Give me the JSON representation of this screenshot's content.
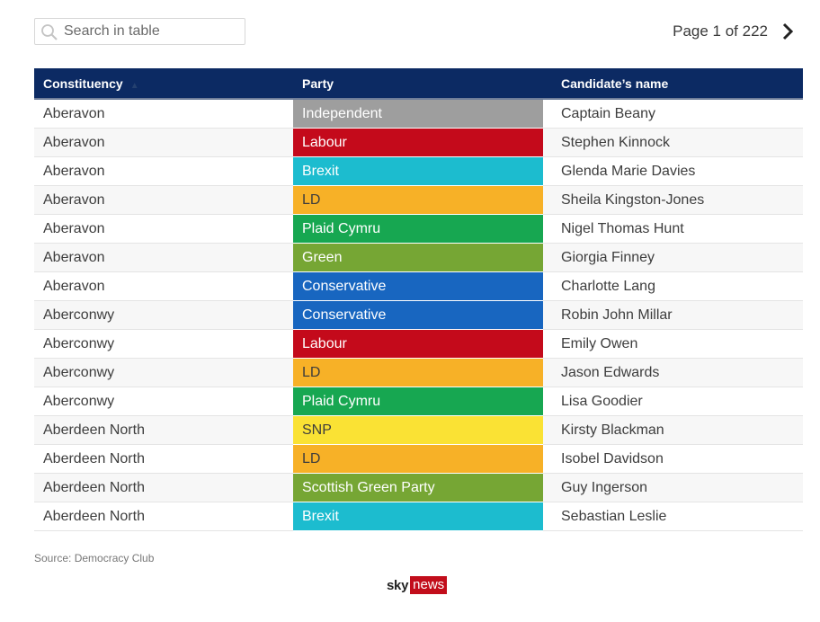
{
  "search": {
    "placeholder": "Search in table",
    "value": ""
  },
  "pager": {
    "label": "Page 1 of 222"
  },
  "table": {
    "headers": [
      "Constituency",
      "Party",
      "Candidate’s name"
    ],
    "rows": [
      {
        "constituency": "Aberavon",
        "party": "Independent",
        "color": "#9e9e9e",
        "dark": false,
        "candidate": "Captain Beany"
      },
      {
        "constituency": "Aberavon",
        "party": "Labour",
        "color": "#c40a1b",
        "dark": false,
        "candidate": "Stephen Kinnock"
      },
      {
        "constituency": "Aberavon",
        "party": "Brexit",
        "color": "#1cbccf",
        "dark": false,
        "candidate": "Glenda Marie Davies"
      },
      {
        "constituency": "Aberavon",
        "party": "LD",
        "color": "#f7b127",
        "dark": true,
        "candidate": "Sheila Kingston-Jones"
      },
      {
        "constituency": "Aberavon",
        "party": "Plaid Cymru",
        "color": "#17a751",
        "dark": false,
        "candidate": "Nigel Thomas Hunt"
      },
      {
        "constituency": "Aberavon",
        "party": "Green",
        "color": "#76a634",
        "dark": false,
        "candidate": "Giorgia Finney"
      },
      {
        "constituency": "Aberavon",
        "party": "Conservative",
        "color": "#1866c0",
        "dark": false,
        "candidate": "Charlotte Lang"
      },
      {
        "constituency": "Aberconwy",
        "party": "Conservative",
        "color": "#1866c0",
        "dark": false,
        "candidate": "Robin John Millar"
      },
      {
        "constituency": "Aberconwy",
        "party": "Labour",
        "color": "#c40a1b",
        "dark": false,
        "candidate": "Emily Owen"
      },
      {
        "constituency": "Aberconwy",
        "party": "LD",
        "color": "#f7b127",
        "dark": true,
        "candidate": "Jason Edwards"
      },
      {
        "constituency": "Aberconwy",
        "party": "Plaid Cymru",
        "color": "#17a751",
        "dark": false,
        "candidate": "Lisa Goodier"
      },
      {
        "constituency": "Aberdeen North",
        "party": "SNP",
        "color": "#fae234",
        "dark": true,
        "candidate": "Kirsty Blackman"
      },
      {
        "constituency": "Aberdeen North",
        "party": "LD",
        "color": "#f7b127",
        "dark": true,
        "candidate": "Isobel Davidson"
      },
      {
        "constituency": "Aberdeen North",
        "party": "Scottish Green Party",
        "color": "#76a634",
        "dark": false,
        "candidate": "Guy Ingerson"
      },
      {
        "constituency": "Aberdeen North",
        "party": "Brexit",
        "color": "#1cbccf",
        "dark": false,
        "candidate": "Sebastian Leslie"
      }
    ]
  },
  "footer": {
    "source": "Source: Democracy Club",
    "logo_sky": "sky",
    "logo_news": "news"
  }
}
